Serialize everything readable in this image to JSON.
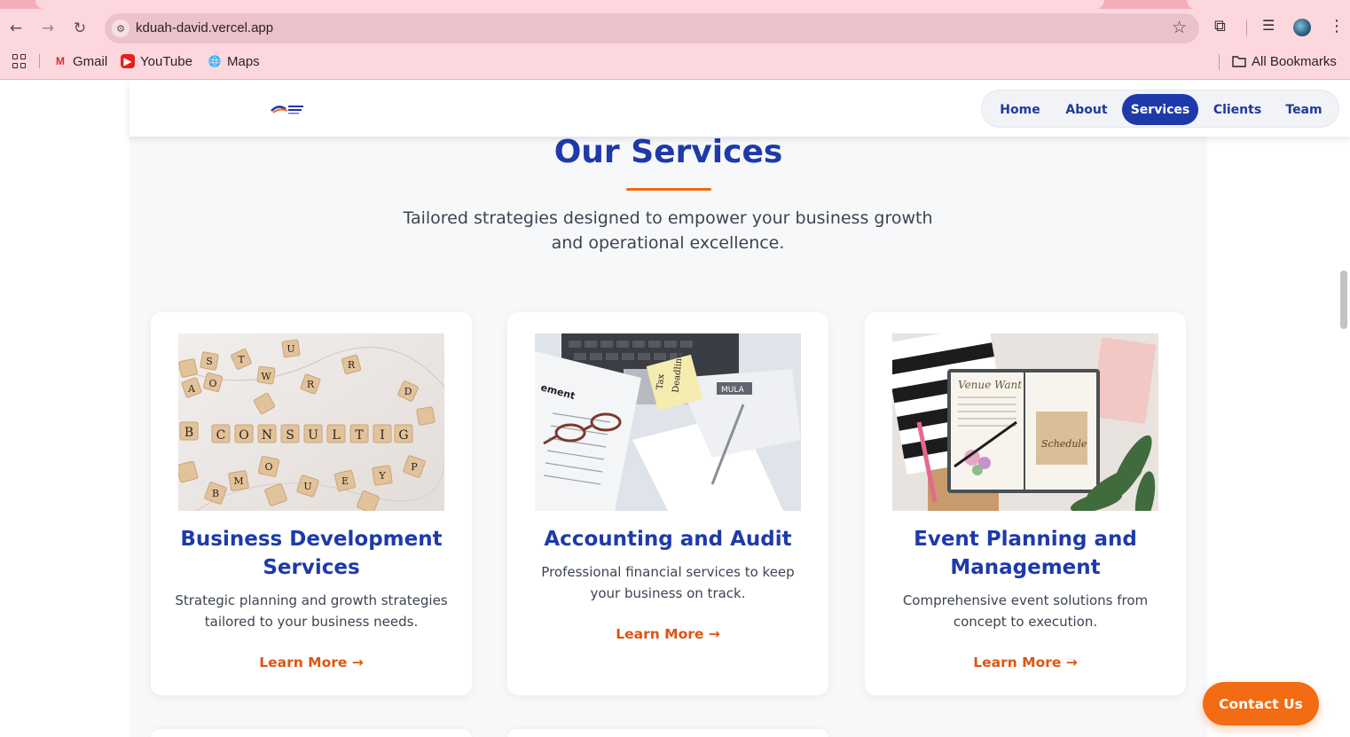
{
  "browser": {
    "url": "kduah-david.vercel.app",
    "bookmarks": [
      {
        "label": "Gmail",
        "icon": "gmail-icon"
      },
      {
        "label": "YouTube",
        "icon": "youtube-icon"
      },
      {
        "label": "Maps",
        "icon": "maps-icon"
      }
    ],
    "all_bookmarks_label": "All Bookmarks"
  },
  "header": {
    "nav": [
      {
        "label": "Home",
        "active": false
      },
      {
        "label": "About",
        "active": false
      },
      {
        "label": "Services",
        "active": true
      },
      {
        "label": "Clients",
        "active": false
      },
      {
        "label": "Team",
        "active": false
      }
    ]
  },
  "services": {
    "title": "Our Services",
    "subtitle": "Tailored strategies designed to empower your business growth and operational excellence.",
    "cards": [
      {
        "title": "Business Development Services",
        "description": "Strategic planning and growth strategies tailored to your business needs.",
        "link": "Learn More →",
        "image": "consulting-letter-tiles"
      },
      {
        "title": "Accounting and Audit",
        "description": "Professional financial services to keep your business on track.",
        "link": "Learn More →",
        "image": "tax-deadline-documents",
        "image_text": "Tax Deadline"
      },
      {
        "title": "Event Planning and Management",
        "description": "Comprehensive event solutions from concept to execution.",
        "link": "Learn More →",
        "image": "event-planning-notebook",
        "image_text": [
          "Venue Want",
          "Schedule"
        ]
      }
    ]
  },
  "contact_button": "Contact Us",
  "colors": {
    "primary": "#1e3aaa",
    "accent": "#f26a0f",
    "chrome": "#fcd8de"
  }
}
